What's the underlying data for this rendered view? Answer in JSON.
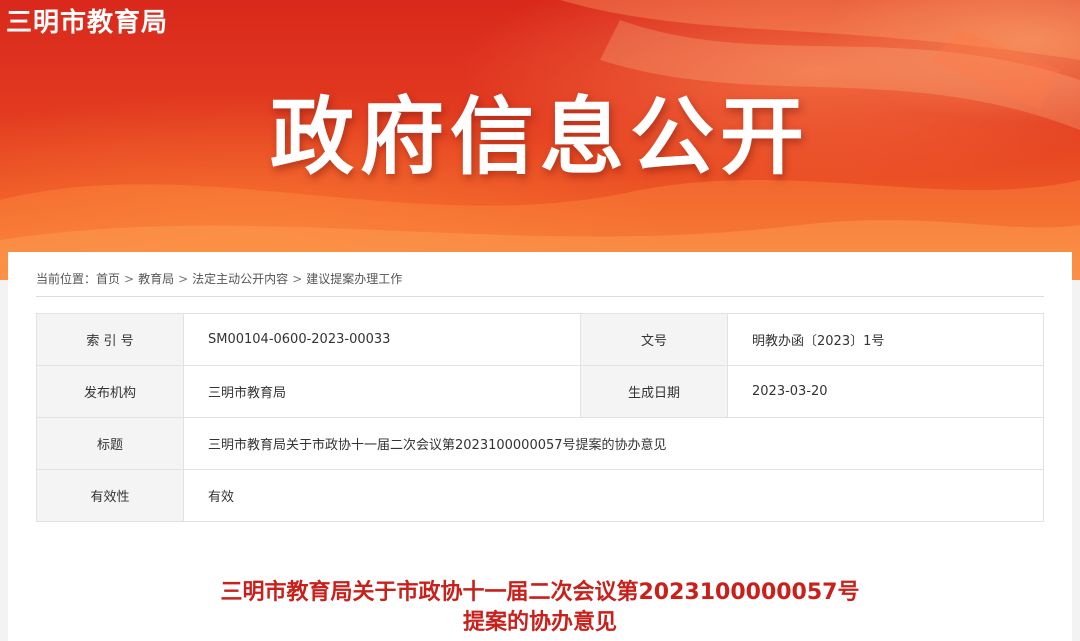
{
  "header": {
    "site_name": "三明市教育局",
    "banner_title": "政府信息公开"
  },
  "breadcrumb": {
    "prefix": "当前位置：",
    "items": [
      "首页",
      "教育局",
      "法定主动公开内容",
      "建议提案办理工作"
    ],
    "separator": ">"
  },
  "meta_table": {
    "index_label": "索 引 号",
    "index_value": "SM00104-0600-2023-00033",
    "doc_no_label": "文号",
    "doc_no_value": "明教办函〔2023〕1号",
    "publisher_label": "发布机构",
    "publisher_value": "三明市教育局",
    "date_label": "生成日期",
    "date_value": "2023-03-20",
    "title_label": "标题",
    "title_value": "三明市教育局关于市政协十一届二次会议第2023100000057号提案的协办意见",
    "validity_label": "有效性",
    "validity_value": "有效"
  },
  "article": {
    "title_line1": "三明市教育局关于市政协十一届二次会议第2023100000057号",
    "title_line2": "提案的协办意见"
  },
  "colors": {
    "banner_red": "#d9281c",
    "banner_orange": "#f47a34",
    "title_red": "#c9201b"
  }
}
